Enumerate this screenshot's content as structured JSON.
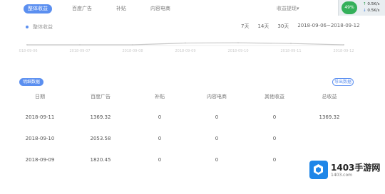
{
  "tabs": [
    {
      "label": "整体收益",
      "active": true
    },
    {
      "label": "百度广告",
      "active": false
    },
    {
      "label": "补贴",
      "active": false
    },
    {
      "label": "内容电商",
      "active": false
    }
  ],
  "topright": {
    "label": "收益提现▾"
  },
  "network": {
    "percent": "49%",
    "up": "0.5K/s",
    "down": "0.5K/s"
  },
  "chart": {
    "legend": "整体收益",
    "range_options": [
      "7天",
      "14天",
      "30天"
    ],
    "date_range": "2018-09-06~2018-09-12",
    "x_labels": [
      "2018-09-06",
      "2018-09-07",
      "2018-09-08",
      "2018-09-09",
      "2018-09-10",
      "2018-09-11",
      "2018-09-12"
    ]
  },
  "chart_data": {
    "type": "line",
    "categories": [
      "2018-09-06",
      "2018-09-07",
      "2018-09-08",
      "2018-09-09",
      "2018-09-10",
      "2018-09-11",
      "2018-09-12"
    ],
    "series": [
      {
        "name": "整体收益",
        "values": [
          0,
          0,
          0,
          1820.45,
          2053.58,
          1369.32,
          0
        ]
      }
    ],
    "color": "#5b8ff0"
  },
  "section": {
    "title": "明细数据",
    "export": "导出数据"
  },
  "table": {
    "headers": [
      "日期",
      "百度广告",
      "补贴",
      "内容电商",
      "其他收益",
      "总收益"
    ],
    "rows": [
      [
        "2018-09-11",
        "1369.32",
        "0",
        "0",
        "0",
        "1369.32"
      ],
      [
        "2018-09-10",
        "2053.58",
        "0",
        "0",
        "0",
        ""
      ],
      [
        "2018-09-09",
        "1820.45",
        "0",
        "0",
        "0",
        ""
      ]
    ]
  },
  "watermark": {
    "title": "1403手游网",
    "url": "1403.com"
  }
}
